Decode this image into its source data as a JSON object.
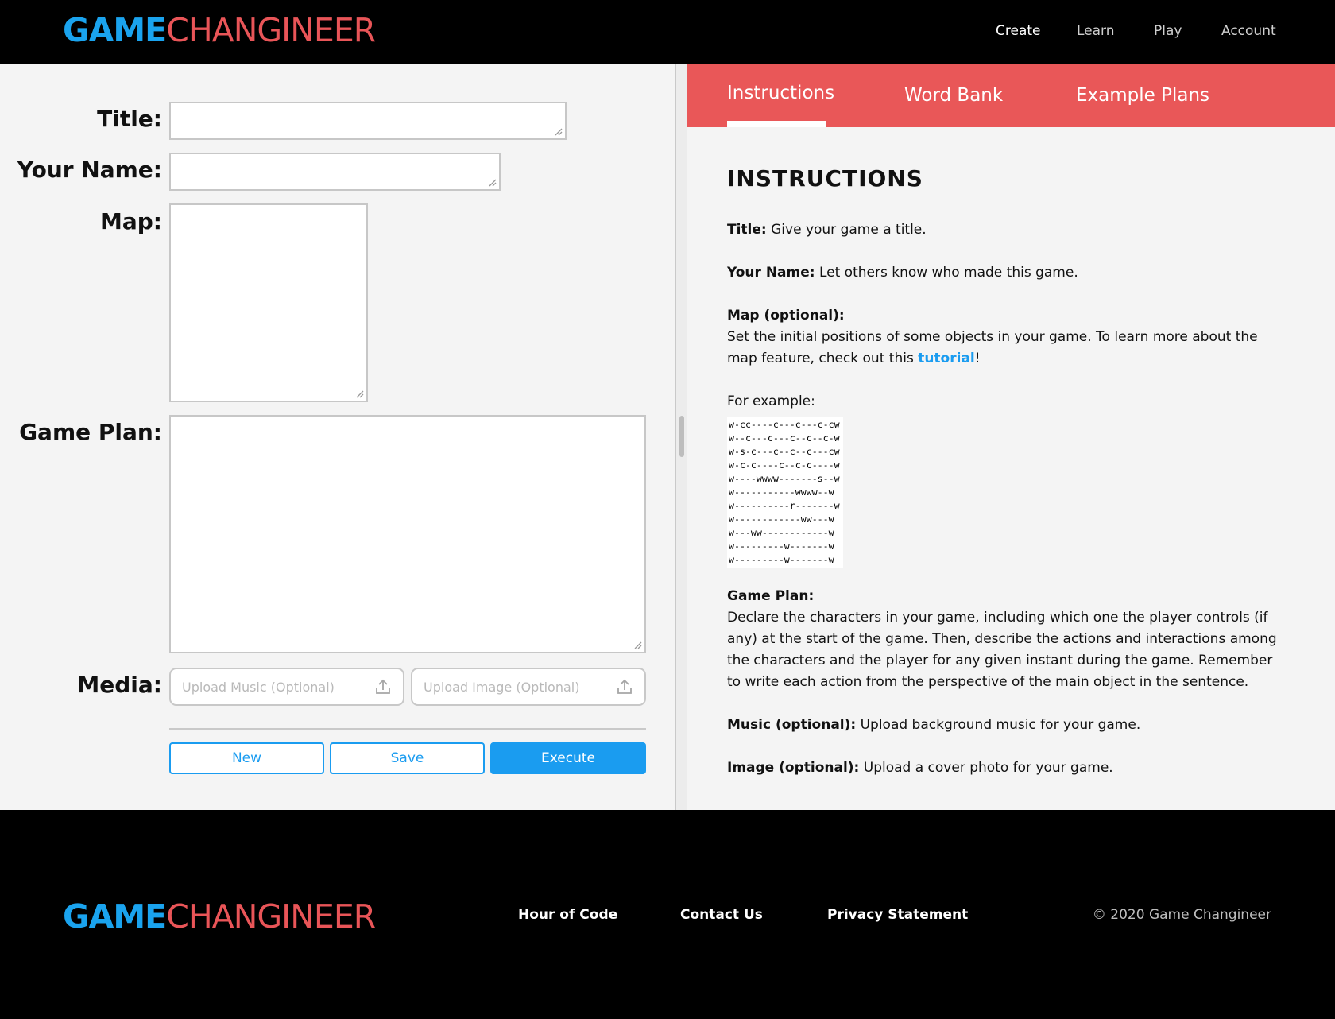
{
  "header": {
    "logo_part1": "GAME",
    "logo_part2": "CHANGINEER",
    "nav": [
      "Create",
      "Learn",
      "Play",
      "Account"
    ]
  },
  "form": {
    "title_label": "Title:",
    "name_label": "Your Name:",
    "map_label": "Map:",
    "plan_label": "Game Plan:",
    "media_label": "Media:",
    "music_placeholder": "Upload Music (Optional)",
    "image_placeholder": "Upload Image (Optional)",
    "new_label": "New",
    "save_label": "Save",
    "execute_label": "Execute"
  },
  "panel": {
    "tabs": [
      "Instructions",
      "Word Bank",
      "Example Plans"
    ],
    "heading": "INSTRUCTIONS",
    "title_term": "Title:",
    "title_desc": " Give your game a title.",
    "name_term": "Your Name:",
    "name_desc": " Let others know who made this game.",
    "map_term": "Map (optional):",
    "map_desc": "Set the initial positions of some objects in your game. To learn more about the map feature, check out this ",
    "map_link": "tutorial",
    "map_after": "!",
    "example_label": "For example:",
    "map_example": [
      "w-cc----c---c---c-cw",
      "w--c---c---c--c--c-w",
      "w-s-c---c--c--c---cw",
      "w-c-c----c--c-c----w",
      "w----wwww-------s--w",
      "w-----------wwww--w",
      "w----------r-------w",
      "w------------ww---w",
      "w---ww------------w",
      "w---------w-------w",
      "w---------w-------w"
    ],
    "plan_term": "Game Plan:",
    "plan_desc": "Declare the characters in your game, including which one the player controls (if any) at the start of the game. Then, describe the actions and interactions among the characters and the player for any given instant during the game. Remember to write each action from the perspective of the main object in the sentence.",
    "music_term": "Music (optional):",
    "music_desc": " Upload background music for your game.",
    "image_term": "Image (optional):",
    "image_desc": " Upload a cover photo for your game."
  },
  "footer": {
    "logo_part1": "GAME",
    "logo_part2": "CHANGINEER",
    "links": [
      "Hour of Code",
      "Contact Us",
      "Privacy Statement"
    ],
    "copyright": "© 2020 Game Changineer"
  },
  "colors": {
    "brand_blue": "#1aa3ee",
    "brand_red": "#e95558",
    "tab_bar": "#e95758",
    "button_blue": "#1a9cf0"
  }
}
